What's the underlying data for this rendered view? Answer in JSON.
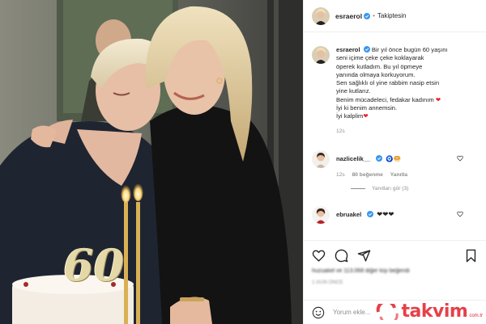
{
  "post": {
    "username": "esraerol",
    "follow_status": "Takiptesin",
    "caption_lines": [
      "Bir yıl önce bugün 60 yaşını",
      "seni içime çeke çeke koklayarak",
      "öperek kutladım. Bu yıl öpmeye",
      "yanında olmaya korkuyorum.",
      "Sen sağlıklı ol yine rabbim nasip etsin",
      "yine kutlarız.",
      "Benim mücadeleci, fedakar kadınım",
      "İyi ki benim annemsin.",
      "İyi kalplim"
    ],
    "caption_time": "12s",
    "cake_number": "60"
  },
  "comments": [
    {
      "username": "nazlicelik__",
      "text": "🧿🥯",
      "time": "12s",
      "likes": "80 beğenme",
      "reply_label": "Yanıtla",
      "view_replies": "Yanıtları gör (3)"
    },
    {
      "username": "ebruakel",
      "text": "❤❤❤",
      "time": "",
      "likes": "",
      "reply_label": "",
      "view_replies": ""
    }
  ],
  "engagement": {
    "likes_text": "huzuakel ve 113.068 diğer kişi beğendi",
    "timestamp": "1 GÜN ÖNCE"
  },
  "add_comment": {
    "placeholder": "Yorum ekle..."
  },
  "watermark": {
    "brand": "takvim",
    "domain": "com.tr"
  },
  "icons": {
    "verified": "verified-badge-icon",
    "like": "heart-icon",
    "comment": "comment-icon",
    "share": "share-icon",
    "save": "bookmark-icon",
    "emoji": "smiley-icon"
  },
  "colors": {
    "verified_blue": "#3897f0",
    "heart_red": "#ed1c24",
    "watermark_red": "#e21e28"
  }
}
